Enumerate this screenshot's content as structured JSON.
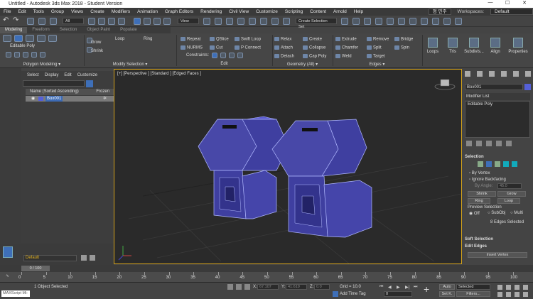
{
  "app": {
    "title": "Untitled - Autodesk 3ds Max 2018 - Student Version",
    "win_min": "—",
    "win_max": "☐",
    "win_close": "✕"
  },
  "menu": [
    "File",
    "Edit",
    "Tools",
    "Group",
    "Views",
    "Create",
    "Modifiers",
    "Animation",
    "Graph Editors",
    "Rendering",
    "Civil View",
    "Customize",
    "Scripting",
    "Content",
    "Arnold",
    "Help"
  ],
  "user": "정 민주",
  "workspaces_label": "Workspaces:",
  "workspace_value": "Default",
  "toolbar": {
    "filter_all": "All",
    "view_label": "View",
    "create_sel_set": "Create Selection Set"
  },
  "ribbon_tabs": [
    "Modeling",
    "Freeform",
    "Selection",
    "Object Paint",
    "Populate"
  ],
  "ribbon": {
    "editable_poly": "Editable Poly",
    "polygon_modeling": "Polygon Modeling ▾",
    "grow": "Grow",
    "shrink": "Shrink",
    "loop": "Loop",
    "ring": "Ring",
    "modify_selection": "Modify Selection ▾",
    "repeat": "Repeat",
    "qslice": "QSlice",
    "swift_loop": "Swift Loop",
    "nurms": "NURMS",
    "cut": "Cut",
    "p_connect": "P Connect",
    "constraints": "Constraints:",
    "edit": "Edit",
    "relax": "Relax",
    "create": "Create",
    "attach": "Attach",
    "collapse": "Collapse",
    "detach": "Detach",
    "cap_poly": "Cap Poly",
    "geometry_all": "Geometry (All) ▾",
    "extrude": "Extrude",
    "remove": "Remove",
    "bridge": "Bridge",
    "chamfer": "Chamfer",
    "split": "Split",
    "spin": "Spin",
    "weld": "Weld",
    "target": "Target",
    "edges": "Edges ▾",
    "loops": "Loops",
    "tris": "Tris",
    "subdivision": "Subdivis...",
    "align": "Align",
    "properties": "Properties"
  },
  "scene_explorer": {
    "menu": [
      "Select",
      "Display",
      "Edit",
      "Customize"
    ],
    "col_name": "Name (Sorted Ascending)",
    "col_frozen": "Frozen",
    "object": "Box001",
    "layer": "Default"
  },
  "viewport": {
    "label": "[+] [Perspective ] [Standard ] [Edged Faces ]"
  },
  "command_panel": {
    "object_name": "Box001",
    "color": "#5560d8",
    "modifier_list": "Modifier List",
    "stack_item": "Editable Poly",
    "selection_title": "Selection",
    "by_vertex": "By Vertex",
    "ignore_backfacing": "Ignore Backfacing",
    "by_angle": "By Angle:",
    "angle_value": "45.0",
    "shrink": "Shrink",
    "grow": "Grow",
    "ring": "Ring",
    "loop": "Loop",
    "preview_selection": "Preview Selection",
    "off": "Off",
    "subobj": "SubObj",
    "multi": "Multi",
    "edges_selected": "8 Edges Selected",
    "soft_selection": "Soft Selection",
    "edit_edges": "Edit Edges",
    "insert_vertex": "Insert Vertex"
  },
  "timeline": {
    "frame": "0 / 100",
    "ticks": [
      "0",
      "5",
      "10",
      "15",
      "20",
      "25",
      "30",
      "35",
      "40",
      "45",
      "50",
      "55",
      "60",
      "65",
      "70",
      "75",
      "80",
      "85",
      "90",
      "95",
      "100"
    ]
  },
  "status": {
    "maxscript": "MAXScript Mi:",
    "selected": "1 Object Selected",
    "x_label": "X:",
    "x_val": "67.107",
    "y_label": "Y:",
    "y_val": "41.619",
    "z_label": "Z:",
    "z_val": "0.0",
    "grid": "Grid = 10.0",
    "add_time_tag": "Add Time Tag",
    "frame_field": "0",
    "auto": "Auto",
    "set_k": "Set K.",
    "selected_dd": "Selected",
    "filters": "Filters..."
  }
}
